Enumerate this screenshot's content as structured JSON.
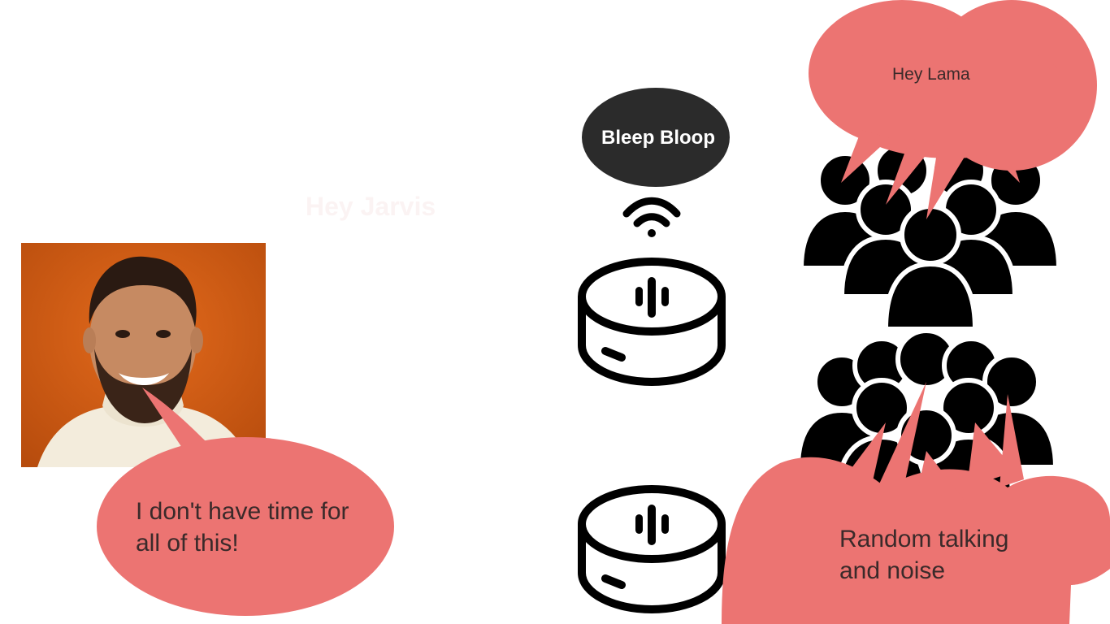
{
  "slide": {
    "ghost_text": "Hey Jarvis",
    "man_bubble": {
      "line1": "I don't have time for",
      "line2": "all of this!"
    },
    "device_bubble": "Bleep Bloop",
    "crowd_bubble": "Hey Lama",
    "noise_bubble": {
      "line1": "Random talking",
      "line2": "and noise"
    }
  },
  "colors": {
    "bubble": "#ec7472",
    "device_bubble": "#2b2b2b",
    "icon": "#000000",
    "background": "#ffffff"
  },
  "icons": [
    "smart-speaker-icon",
    "wifi-signal-icon",
    "crowd-icon"
  ]
}
